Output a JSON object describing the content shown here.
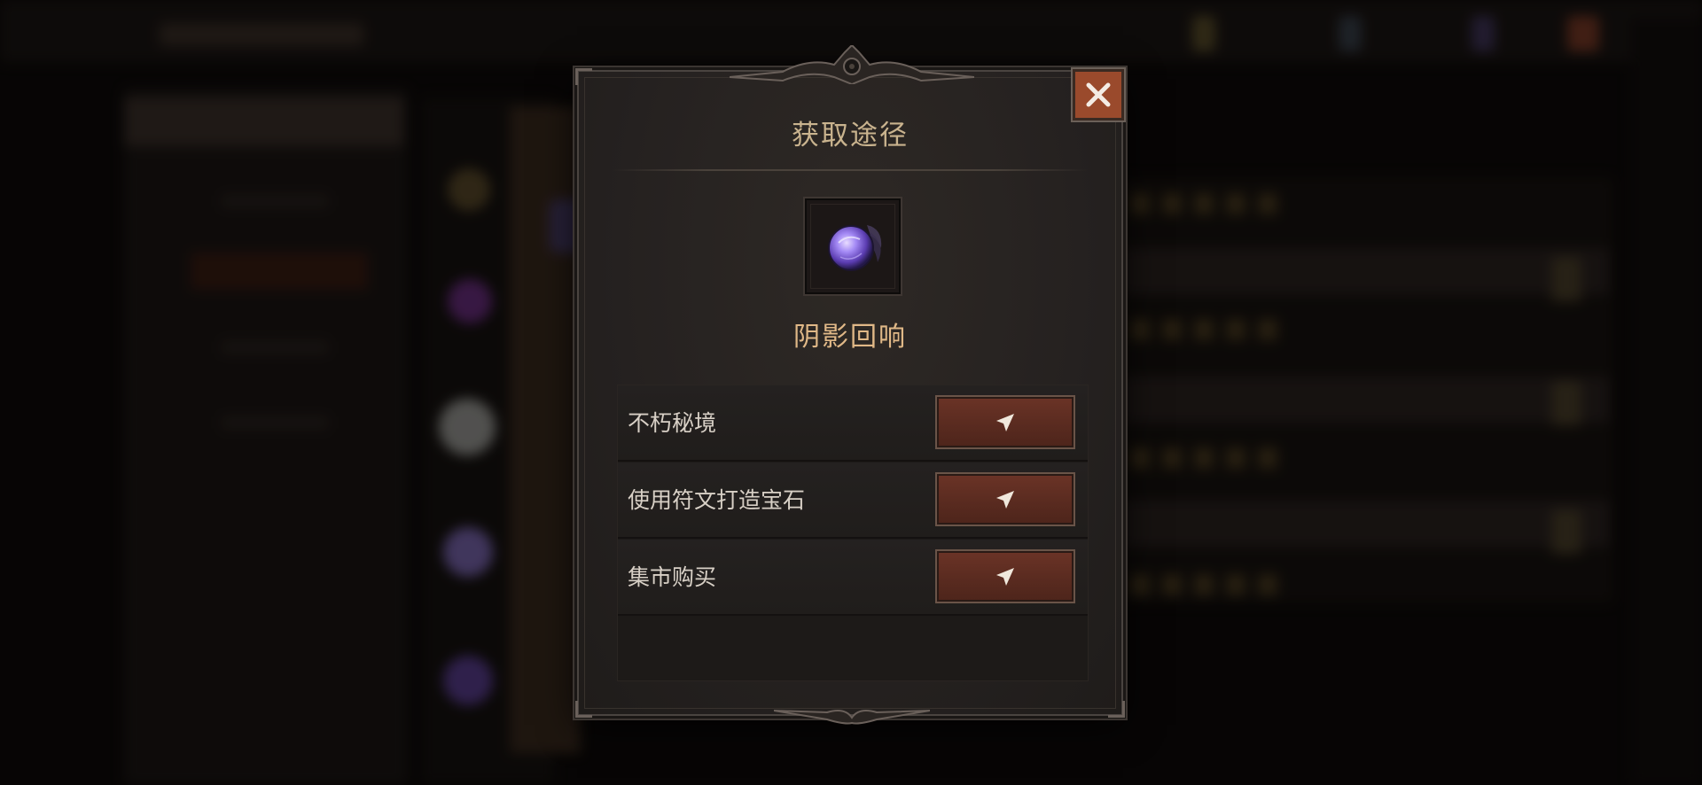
{
  "dialog": {
    "title": "获取途径",
    "item_name": "阴影回响",
    "item_icon": "purple-orb-icon",
    "close_icon": "close-icon",
    "sources": [
      {
        "label": "不朽秘境",
        "button_icon": "navigate-arrow-icon"
      },
      {
        "label": "使用符文打造宝石",
        "button_icon": "navigate-arrow-icon"
      },
      {
        "label": "集市购买",
        "button_icon": "navigate-arrow-icon"
      }
    ]
  },
  "colors": {
    "title": "#c9b38e",
    "item_name": "#e0b887",
    "close_button": "#9a4a2c",
    "goto_button": "#5a2b20",
    "orb": "#8a6cf0"
  }
}
